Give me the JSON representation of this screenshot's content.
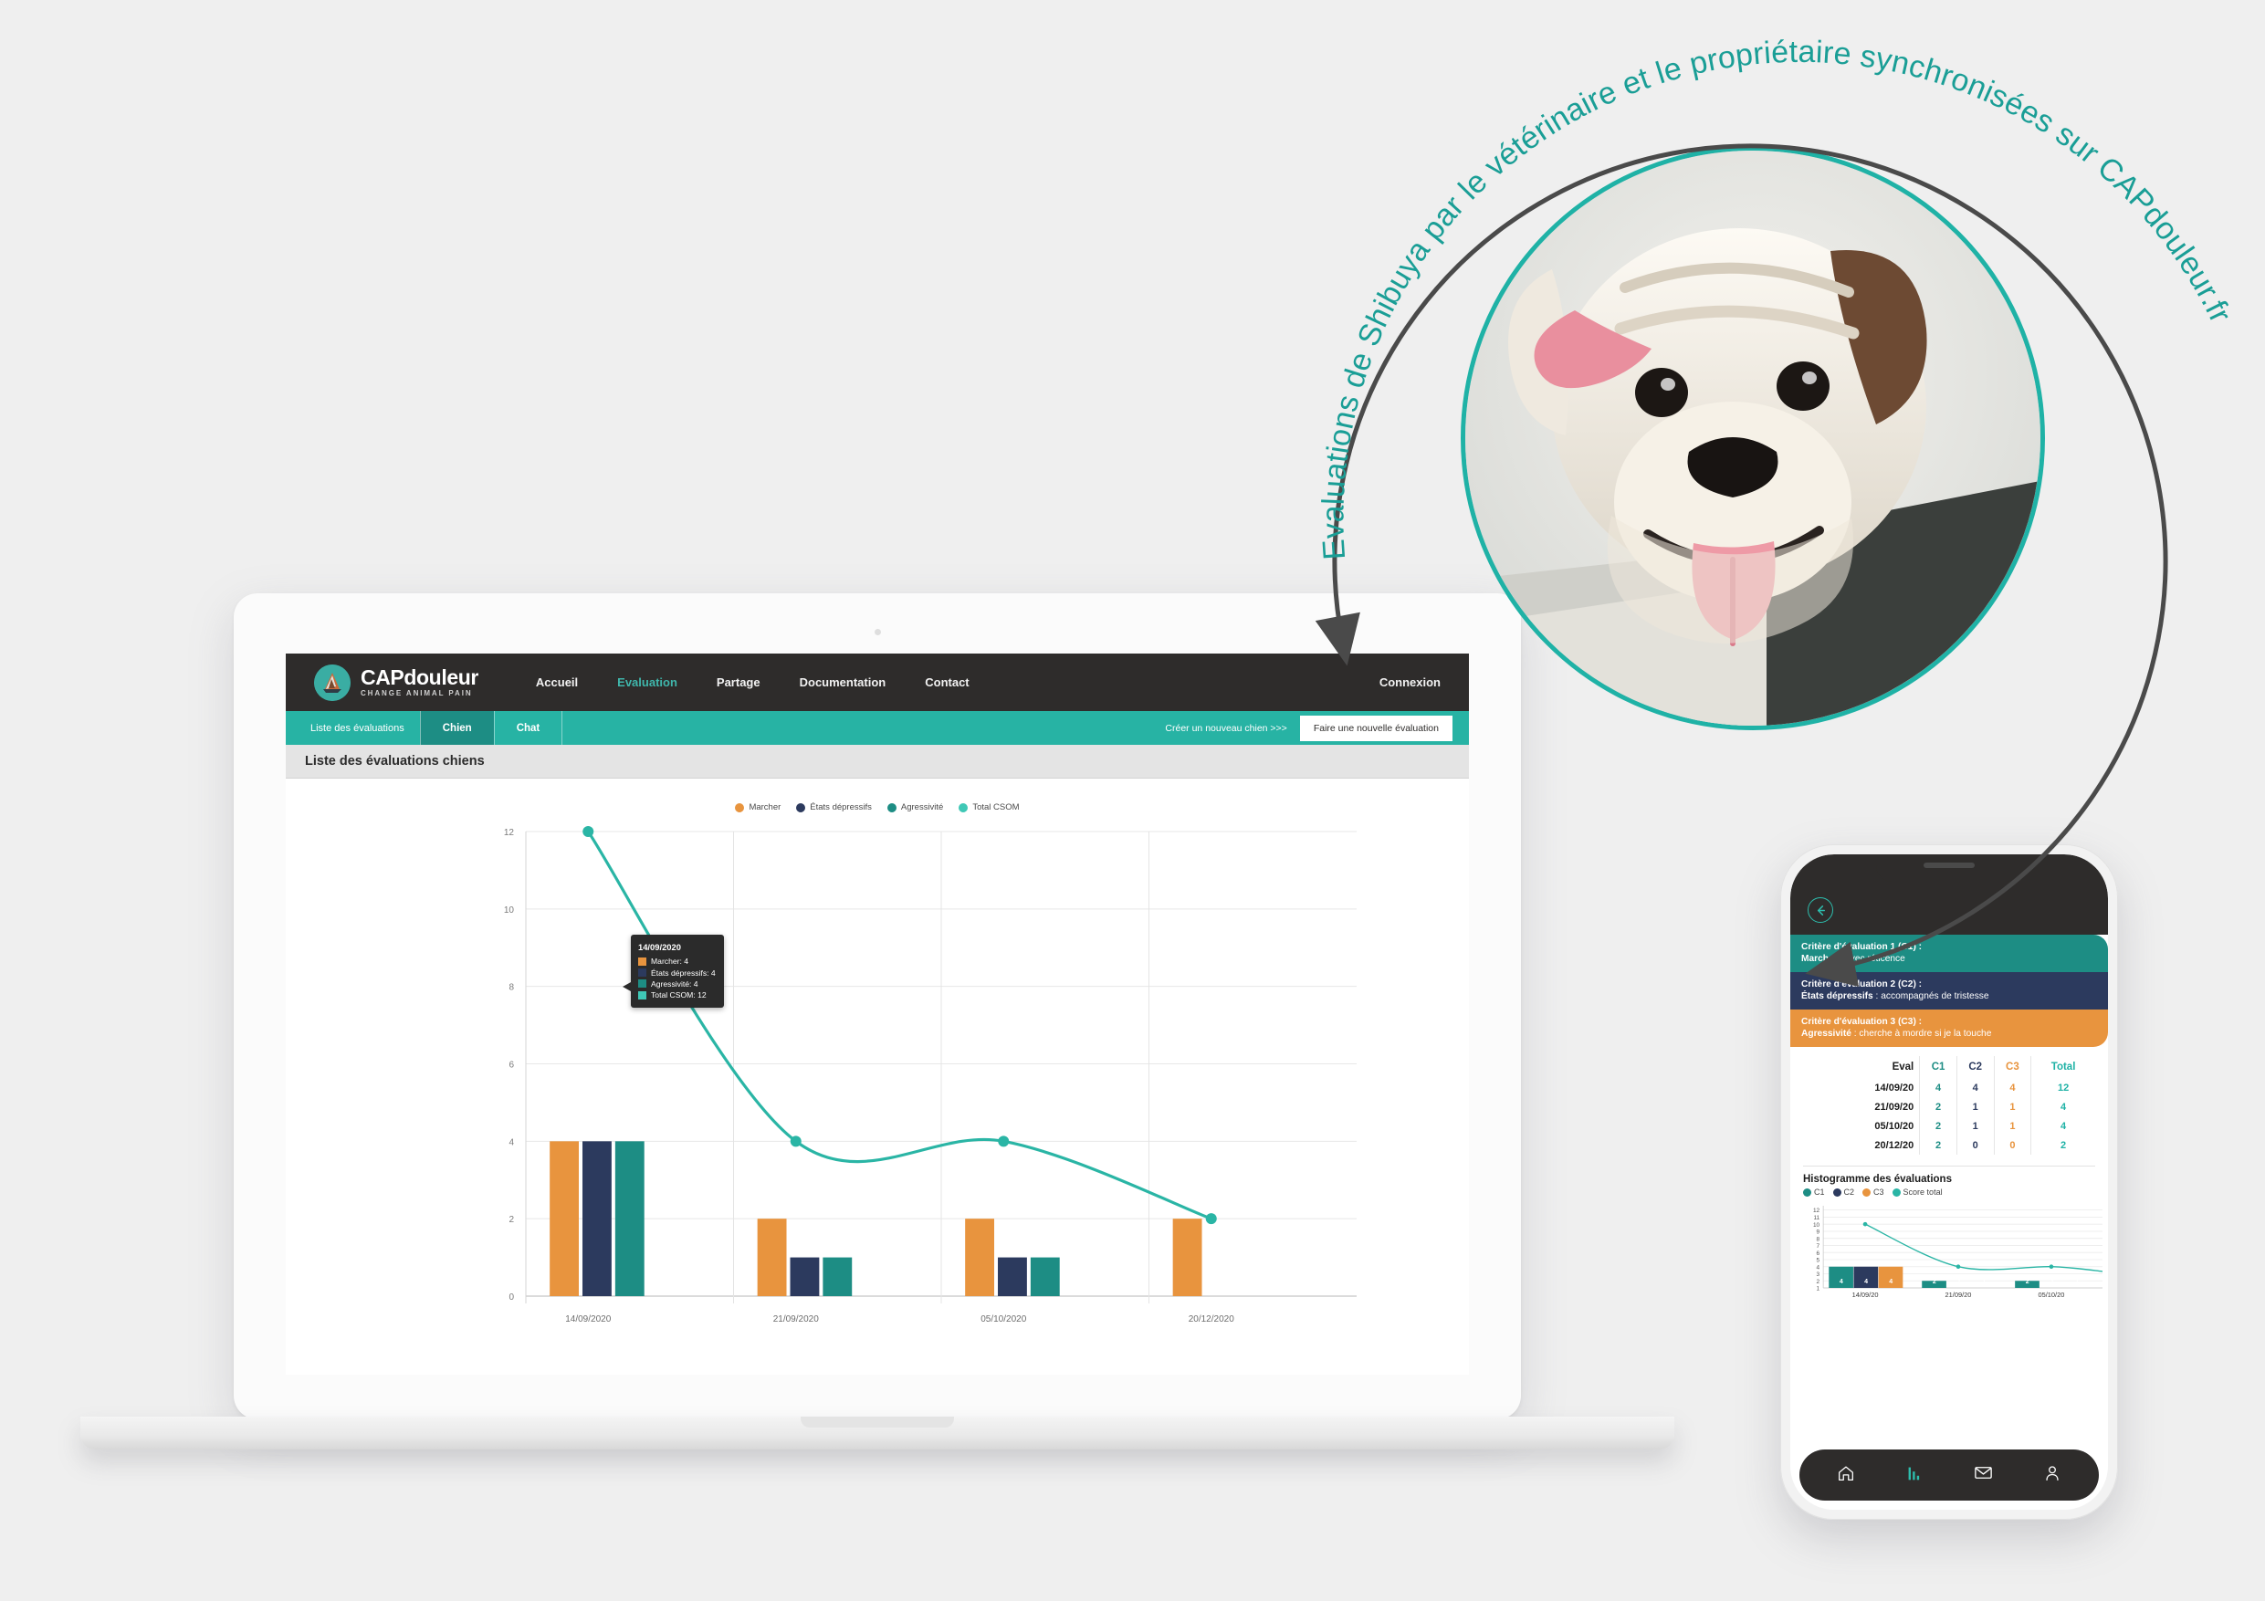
{
  "annotation": {
    "arc_text": "Evaluations de Shibuya par le vétérinaire et le propriétaire synchronisées sur CAPdouleur.fr",
    "arc_color": "#1a9e96",
    "arrow_color": "#4a4a4a",
    "photo_alt": "bulldog-photo"
  },
  "desktop": {
    "navbar": {
      "logo_title_cap": "CAP",
      "logo_title_rest": "douleur",
      "logo_subtitle": "CHANGE ANIMAL PAIN",
      "links": [
        {
          "label": "Accueil",
          "active": false
        },
        {
          "label": "Evaluation",
          "active": true
        },
        {
          "label": "Partage",
          "active": false
        },
        {
          "label": "Documentation",
          "active": false
        },
        {
          "label": "Contact",
          "active": false
        }
      ],
      "login_label": "Connexion"
    },
    "subbar": {
      "title": "Liste des évaluations",
      "tabs": [
        {
          "label": "Chien",
          "active": true
        },
        {
          "label": "Chat",
          "active": false
        }
      ],
      "create_link": "Créer un nouveau chien >>>",
      "eval_button": "Faire une nouvelle évaluation"
    },
    "page_title": "Liste des évaluations chiens",
    "tooltip": {
      "title": "14/09/2020",
      "rows": [
        {
          "label": "Marcher: 4",
          "color": "#e8943e"
        },
        {
          "label": "États dépressifs: 4",
          "color": "#2c3a5e"
        },
        {
          "label": "Agressivité: 4",
          "color": "#1d8d84"
        },
        {
          "label": "Total CSOM: 12",
          "color": "#3fc8b6"
        }
      ]
    }
  },
  "chart_data": {
    "type": "bar",
    "title": "",
    "xlabel": "",
    "ylabel": "",
    "ylim": [
      0,
      12
    ],
    "yticks": [
      0,
      2,
      4,
      6,
      8,
      10,
      12
    ],
    "grid": true,
    "legend_position": "top-center",
    "categories": [
      "14/09/2020",
      "21/09/2020",
      "05/10/2020",
      "20/12/2020"
    ],
    "series": [
      {
        "name": "Marcher",
        "type": "bar",
        "color": "#e8943e",
        "values": [
          4,
          2,
          2,
          2
        ]
      },
      {
        "name": "États dépressifs",
        "type": "bar",
        "color": "#2c3a5e",
        "values": [
          4,
          1,
          1,
          0
        ]
      },
      {
        "name": "Agressivité",
        "type": "bar",
        "color": "#1d8d84",
        "values": [
          4,
          1,
          1,
          0
        ]
      },
      {
        "name": "Total CSOM",
        "type": "line",
        "color": "#2ab5a5",
        "values": [
          12,
          4,
          4,
          2
        ]
      }
    ]
  },
  "phone": {
    "criteria": [
      {
        "line1": "Critère d'évaluation  1 (C1) :",
        "bold": "Marcher",
        "rest": " : avec réticence",
        "color": "#1d8d84"
      },
      {
        "line1": "Critère d'évaluation 2 (C2) :",
        "bold": "États dépressifs",
        "rest": " : accompagnés de tristesse",
        "color": "#2c3a5e"
      },
      {
        "line1": "Critère d'évaluation 3 (C3) :",
        "bold": "Agressivité",
        "rest": " : cherche à mordre si je la touche",
        "color": "#e8943e"
      }
    ],
    "table": {
      "headers": [
        "Eval",
        "C1",
        "C2",
        "C3",
        "Total"
      ],
      "header_colors": [
        "#1c1c1c",
        "#1d8d84",
        "#2c3a5e",
        "#e8943e",
        "#1fb2a6"
      ],
      "rows": [
        [
          "14/09/20",
          "4",
          "4",
          "4",
          "12"
        ],
        [
          "21/09/20",
          "2",
          "1",
          "1",
          "4"
        ],
        [
          "05/10/20",
          "2",
          "1",
          "1",
          "4"
        ],
        [
          "20/12/20",
          "2",
          "0",
          "0",
          "2"
        ]
      ]
    },
    "histogram_title": "Histogramme des évaluations",
    "legend": [
      {
        "label": "C1",
        "color": "#1d8d84"
      },
      {
        "label": "C2",
        "color": "#2c3a5e"
      },
      {
        "label": "C3",
        "color": "#e8943e"
      },
      {
        "label": "Score total",
        "color": "#2ab5a5"
      }
    ],
    "chart": {
      "type": "bar",
      "yticks": [
        12,
        11,
        10,
        9,
        8,
        7,
        6,
        5,
        4,
        3,
        2,
        1
      ],
      "ylim": [
        1,
        12
      ],
      "categories": [
        "14/09/20",
        "21/09/20",
        "05/10/20"
      ],
      "series": [
        {
          "name": "C1",
          "color": "#1d8d84",
          "values": [
            4,
            2,
            2
          ]
        },
        {
          "name": "C2",
          "color": "#2c3a5e",
          "values": [
            4,
            1,
            1
          ]
        },
        {
          "name": "C3",
          "color": "#e8943e",
          "values": [
            4,
            1,
            1
          ]
        },
        {
          "name": "Score total",
          "type": "line",
          "color": "#2ab5a5",
          "values": [
            10,
            4,
            4
          ]
        }
      ]
    },
    "bottom_nav": [
      {
        "icon": "home-icon",
        "active": false
      },
      {
        "icon": "bar-chart-icon",
        "active": true
      },
      {
        "icon": "envelope-icon",
        "active": false
      },
      {
        "icon": "person-icon",
        "active": false
      }
    ]
  }
}
